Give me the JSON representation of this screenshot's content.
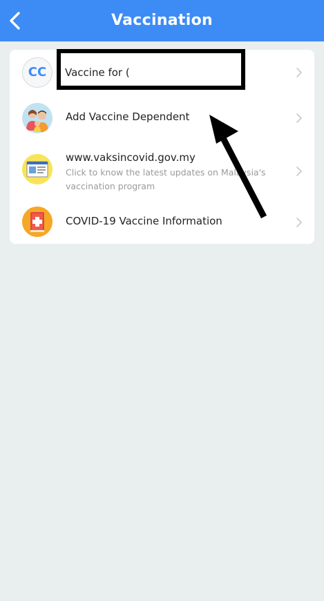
{
  "header": {
    "title": "Vaccination",
    "back_icon": "chevron-left-icon"
  },
  "list": {
    "items": [
      {
        "avatar_text": "CC",
        "label": "Vaccine for (",
        "icon": "initials-avatar"
      },
      {
        "label": "Add Vaccine Dependent",
        "icon": "family-icon"
      },
      {
        "label": "www.vaksincovid.gov.my",
        "sublabel": "Click to know the latest updates on Malaysia's vaccination program",
        "icon": "webpage-icon"
      },
      {
        "label": "COVID-19 Vaccine Information",
        "icon": "medical-book-icon"
      }
    ]
  },
  "colors": {
    "header_bg": "#3d8cf5",
    "page_bg": "#e9eeee",
    "card_bg": "#ffffff",
    "text": "#222222",
    "subtext": "#9a9a9a",
    "chevron": "#c8c8c8"
  }
}
